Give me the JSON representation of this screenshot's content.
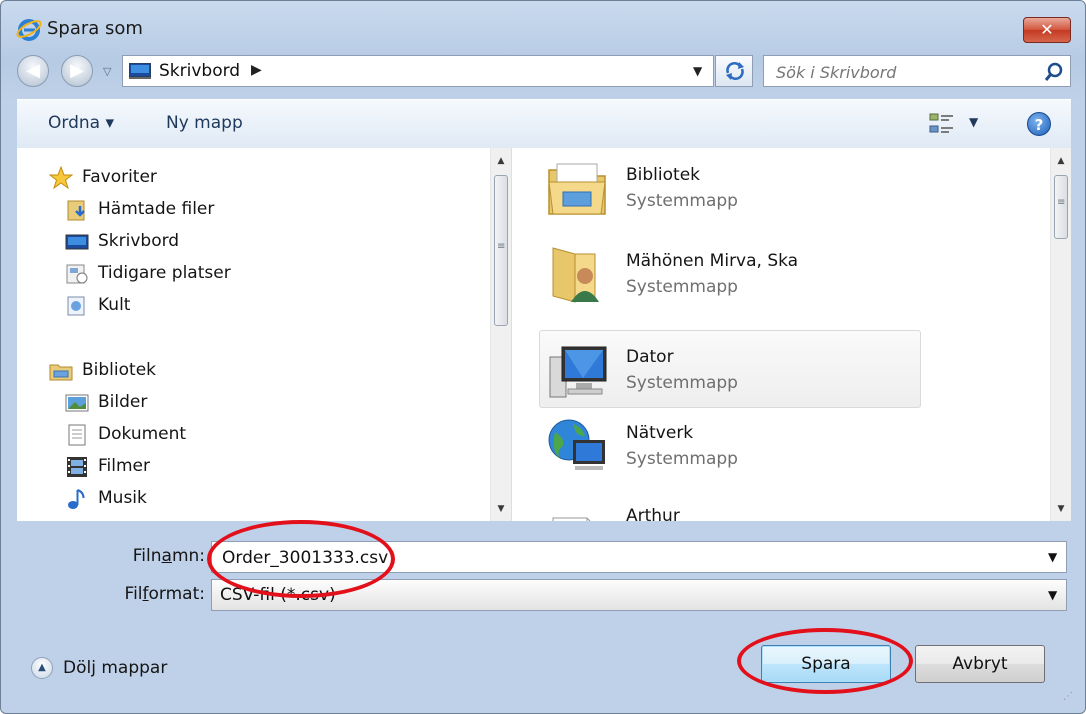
{
  "window": {
    "title": "Spara som",
    "close_label": "✕"
  },
  "address": {
    "location": "Skrivbord",
    "search_placeholder": "Sök i Skrivbord"
  },
  "toolbar": {
    "organize_label": "Ordna ▾",
    "new_folder_label": "Ny mapp",
    "help_label": "?"
  },
  "nav_pane": {
    "favorites_header": "Favoriter",
    "favorites": [
      "Hämtade filer",
      "Skrivbord",
      "Tidigare platser",
      "Kult"
    ],
    "libraries_header": "Bibliotek",
    "libraries": [
      "Bilder",
      "Dokument",
      "Filmer",
      "Musik"
    ]
  },
  "files": [
    {
      "name": "Bibliotek",
      "type": "Systemmapp",
      "icon": "library-folder-icon"
    },
    {
      "name": "Mähönen Mirva, Ska",
      "type": "Systemmapp",
      "icon": "user-folder-icon"
    },
    {
      "name": "Dator",
      "type": "Systemmapp",
      "icon": "computer-icon"
    },
    {
      "name": "Nätverk",
      "type": "Systemmapp",
      "icon": "network-icon"
    },
    {
      "name": "Arthur",
      "type": "",
      "icon": "file-icon"
    }
  ],
  "form": {
    "filename_label_pre": "Filn",
    "filename_label_u": "a",
    "filename_label_post": "mn:",
    "filename_value": "Order_3001333.csv",
    "filetype_label_pre": "Fil",
    "filetype_label_u": "f",
    "filetype_label_post": "ormat:",
    "filetype_value": "CSV-fil (*.csv)"
  },
  "footer": {
    "hide_folders_label": "Dölj mappar",
    "save_label": "Spara",
    "cancel_label": "Avbryt"
  },
  "colors": {
    "highlight_ellipse": "#e2101a",
    "title_close": "#c43a22",
    "accent_text": "#1e395b"
  }
}
